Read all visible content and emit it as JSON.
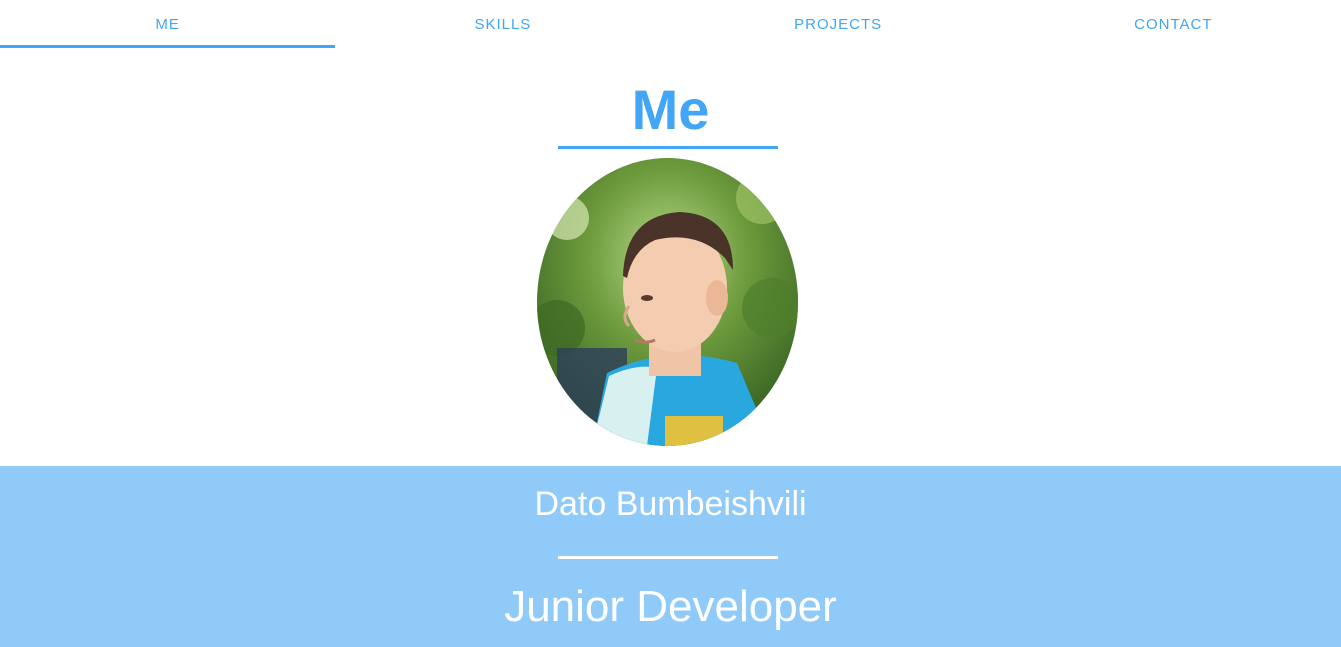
{
  "theme": {
    "accent": "#42a5f5",
    "banner_bg": "#90caf9",
    "banner_text": "#ffffff"
  },
  "nav": {
    "tabs": [
      {
        "label": "ME",
        "active": true
      },
      {
        "label": "SKILLS",
        "active": false
      },
      {
        "label": "PROJECTS",
        "active": false
      },
      {
        "label": "CONTACT",
        "active": false
      }
    ]
  },
  "section": {
    "title": "Me"
  },
  "profile": {
    "photo_icon": "profile-photo",
    "name": "Dato Bumbeishvili",
    "role": "Junior Developer"
  }
}
